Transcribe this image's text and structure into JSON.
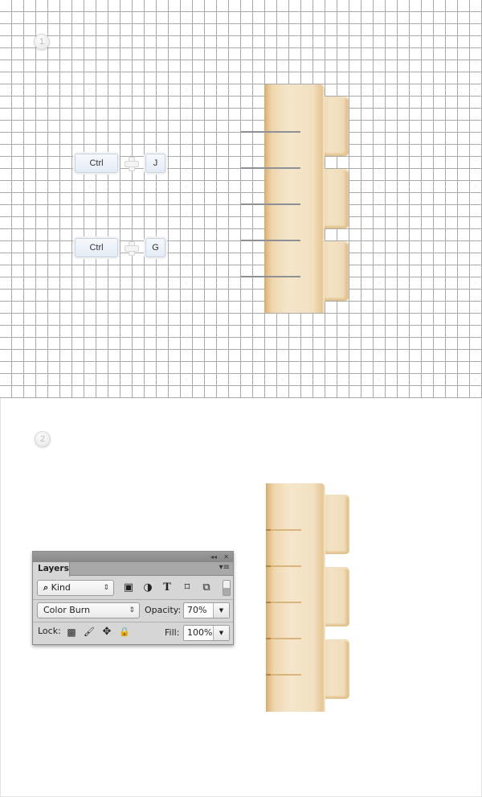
{
  "steps": [
    {
      "number": "1"
    },
    {
      "number": "2"
    }
  ],
  "shortcuts": [
    {
      "modifier": "Ctrl",
      "key": "J"
    },
    {
      "modifier": "Ctrl",
      "key": "G"
    }
  ],
  "colors": {
    "grid_line": "#a9a9a9",
    "ruler_light": "#f5e6cb",
    "ruler_dark": "#d6aa6c",
    "guide_line": "#8d9094",
    "panel_bg": "#d6d6d6"
  },
  "layers_panel": {
    "title_controls": {
      "collapse": "◂◂",
      "close": "✕"
    },
    "tab_label": "Layers",
    "menu_icon": "▾≡",
    "filter": {
      "icon": "search-icon",
      "value": "Kind",
      "arrows": "⇕"
    },
    "filter_icons": [
      {
        "name": "image-filter-icon",
        "glyph": "▣"
      },
      {
        "name": "adjustment-filter-icon",
        "glyph": "◑"
      },
      {
        "name": "type-filter-icon",
        "glyph": "T"
      },
      {
        "name": "shape-filter-icon",
        "glyph": "⌑"
      },
      {
        "name": "smart-object-filter-icon",
        "glyph": "⧉"
      }
    ],
    "blend_mode": {
      "value": "Color Burn",
      "arrows": "⇕"
    },
    "opacity": {
      "label": "Opacity:",
      "value": "70%",
      "drop": "▼"
    },
    "lock": {
      "label": "Lock:",
      "icons": [
        {
          "name": "lock-transparent-pixels-icon",
          "glyph": "▩"
        },
        {
          "name": "lock-image-pixels-icon",
          "glyph": "🖌"
        },
        {
          "name": "lock-position-icon",
          "glyph": "✥"
        },
        {
          "name": "lock-all-icon",
          "glyph": "🔒"
        }
      ]
    },
    "fill": {
      "label": "Fill:",
      "value": "100%",
      "drop": "▼"
    }
  }
}
